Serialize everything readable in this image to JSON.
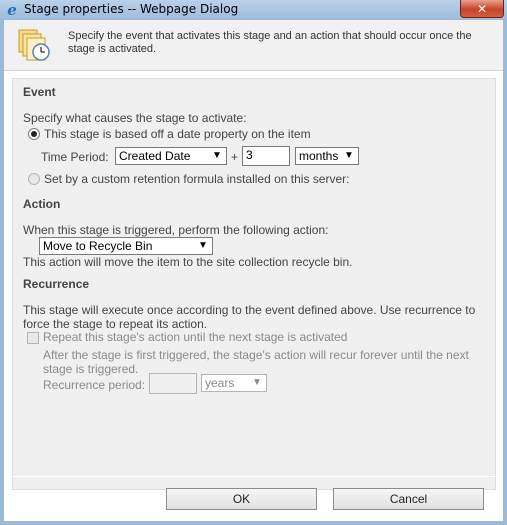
{
  "window": {
    "title": "Stage properties -- Webpage Dialog",
    "close_glyph": "✕"
  },
  "header": {
    "description": "Specify the event that activates this stage and an action that should occur once the stage is activated.",
    "icon": "documents-clock-icon"
  },
  "event": {
    "title": "Event",
    "prompt": "Specify what causes the stage to activate:",
    "option_date_label": "This stage is based off a date property on the item",
    "option_date_selected": true,
    "time_period_label": "Time Period:",
    "date_property_value": "Created Date",
    "plus_sign": "+",
    "amount_value": "3",
    "unit_value": "months",
    "option_formula_label": "Set by a custom retention formula installed on this server:",
    "option_formula_selected": false
  },
  "action": {
    "title": "Action",
    "prompt": "When this stage is triggered, perform the following action:",
    "selected_action": "Move to Recycle Bin",
    "description": "This action will move the item to the site collection recycle bin."
  },
  "recurrence": {
    "title": "Recurrence",
    "description": "This stage will execute once according to the event defined above. Use recurrence to force the stage to repeat its action.",
    "repeat_label": "Repeat this stage's action until the next stage is activated",
    "repeat_checked": false,
    "note": "After the stage is first triggered, the stage's action will recur forever until the next stage is triggered.",
    "period_label": "Recurrence period:",
    "period_value": "",
    "period_unit": "years"
  },
  "footer": {
    "ok_label": "OK",
    "cancel_label": "Cancel"
  },
  "colors": {
    "title_bar": "#9dbbdb",
    "close_button": "#c7432b",
    "panel_background": "#f0f0f0"
  }
}
